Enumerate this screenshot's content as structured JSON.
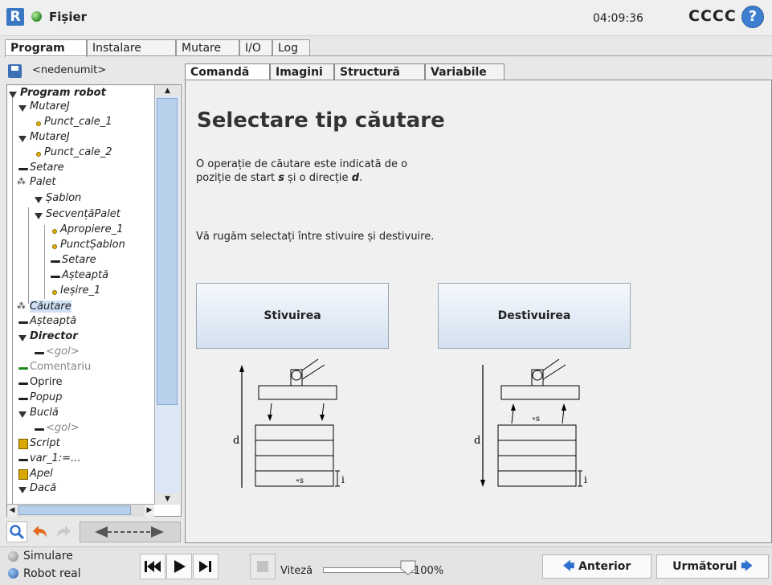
{
  "topbar": {
    "file_menu": "Fișier",
    "clock": "04:09:36",
    "robot_name": "CCCC",
    "help": "?"
  },
  "main_tabs": [
    "Program",
    "Instalare",
    "Mutare",
    "I/O",
    "Log"
  ],
  "program": {
    "name": "<nedenumit>",
    "tree": [
      "Program robot",
      "MutareJ",
      "Punct_cale_1",
      "MutareJ",
      "Punct_cale_2",
      "Setare",
      "Palet",
      "Șablon",
      "SecvențăPalet",
      "Apropiere_1",
      "PunctȘablon",
      "Setare",
      "Așteaptă",
      "Ieșire_1",
      "Căutare",
      "Așteaptă",
      "Director",
      "<gol>",
      "Comentariu",
      "Oprire",
      "Popup",
      "Buclă",
      "<gol>",
      "Script",
      "var_1:=...",
      "Apel",
      "Dacă"
    ]
  },
  "sub_tabs": [
    "Comandă",
    "Imagini",
    "Structură",
    "Variabile"
  ],
  "content": {
    "title": "Selectare tip căutare",
    "desc_line1": "O operație de căutare este indicată de o",
    "desc_line2_pre": "poziție de start ",
    "desc_s": "s",
    "desc_line2_mid": " și o direcție ",
    "desc_d": "d",
    "desc_line2_end": ".",
    "desc3": "Vă rugăm selectați între stivuire și destivuire.",
    "stack_button": "Stivuirea",
    "destack_button": "Destivuirea",
    "diagram_d": "d",
    "diagram_s": "s",
    "diagram_i": "i"
  },
  "bottom": {
    "simulation": "Simulare",
    "real_robot": "Robot real",
    "speed_label": "Viteză",
    "speed_value": "100%",
    "speed_fraction": 1.0,
    "prev_button": "Anterior",
    "next_button": "Următorul"
  },
  "colors": {
    "accent_blue": "#3d7ed0",
    "tree_scroll": "#b9d0ec",
    "arrow_blue": "#2f6fd0"
  }
}
